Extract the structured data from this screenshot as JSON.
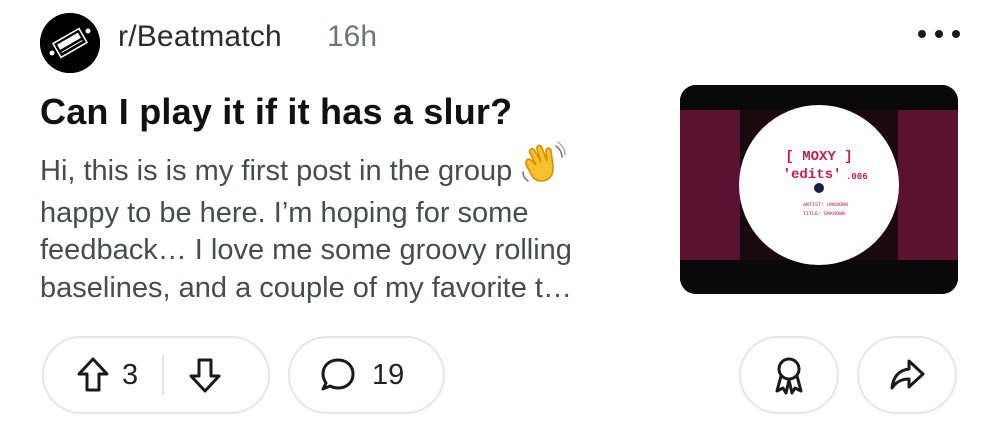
{
  "post": {
    "subreddit": "r/Beatmatch",
    "age": "16h",
    "title": "Can I play it if it has a slur?",
    "body_lines": [
      "Hi, this is is my first post in the group",
      "happy to be here. I’m hoping for some",
      "feedback… I love me some groovy rolling",
      "baselines, and a couple of my favorite t…"
    ],
    "emoji": "waving-hand-icon",
    "thumbnail": {
      "label_top": "[ MOXY ]",
      "label_main": "'edits'",
      "label_number": ".006",
      "label_artist": "ARTIST: UNKNOWN",
      "label_title": "TITLE: UNKNOWN"
    }
  },
  "actions": {
    "upvotes": "3",
    "comments": "19"
  },
  "colors": {
    "thumb_panel": "#5a1230",
    "thumb_text": "#c81b55",
    "border": "#e6e6e6"
  }
}
